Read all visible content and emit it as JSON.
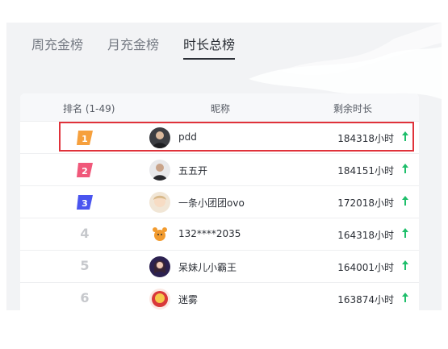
{
  "tabs": [
    {
      "label": "周充金榜",
      "active": false
    },
    {
      "label": "月充金榜",
      "active": false
    },
    {
      "label": "时长总榜",
      "active": true
    }
  ],
  "table": {
    "headers": {
      "rank": "排名 (1-49)",
      "nickname": "昵称",
      "remaining": "剩余时长"
    },
    "rows": [
      {
        "rank": "1",
        "nickname": "pdd",
        "hours": "184318小时",
        "trend": "up"
      },
      {
        "rank": "2",
        "nickname": "五五开",
        "hours": "184151小时",
        "trend": "up"
      },
      {
        "rank": "3",
        "nickname": "一条小团团ovo",
        "hours": "172018小时",
        "trend": "up"
      },
      {
        "rank": "4",
        "nickname": "132****2035",
        "hours": "164318小时",
        "trend": "up"
      },
      {
        "rank": "5",
        "nickname": "呆妹儿小霸王",
        "hours": "164001小时",
        "trend": "up"
      },
      {
        "rank": "6",
        "nickname": "迷雾",
        "hours": "163874小时",
        "trend": "up"
      }
    ]
  },
  "colors": {
    "rank1": "#f6a03d",
    "rank2": "#f0587a",
    "rank3": "#4a55ef",
    "trend_up": "#1fbf6b",
    "highlight": "#e0323a"
  }
}
